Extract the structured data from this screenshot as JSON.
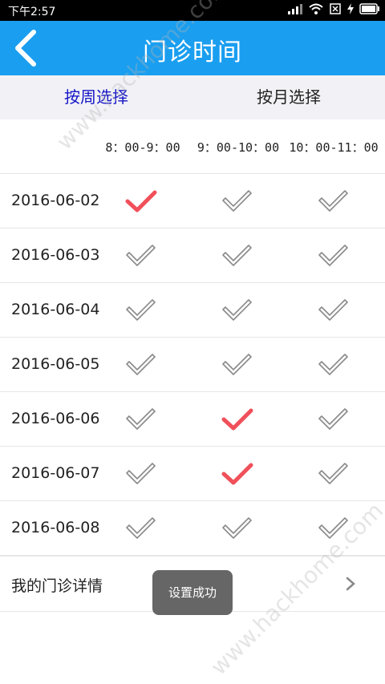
{
  "status_bar": {
    "time": "下午2:57"
  },
  "header": {
    "title": "门诊时间"
  },
  "tabs": [
    {
      "label": "按周选择",
      "active": true
    },
    {
      "label": "按月选择",
      "active": false
    }
  ],
  "schedule": {
    "time_slots": [
      "8：00-9：00",
      "9：00-10：00",
      "10：00-11：00"
    ],
    "rows": [
      {
        "date": "2016-06-02",
        "selected": [
          true,
          false,
          false
        ]
      },
      {
        "date": "2016-06-03",
        "selected": [
          false,
          false,
          false
        ]
      },
      {
        "date": "2016-06-04",
        "selected": [
          false,
          false,
          false
        ]
      },
      {
        "date": "2016-06-05",
        "selected": [
          false,
          false,
          false
        ]
      },
      {
        "date": "2016-06-06",
        "selected": [
          false,
          true,
          false
        ]
      },
      {
        "date": "2016-06-07",
        "selected": [
          false,
          true,
          false
        ]
      },
      {
        "date": "2016-06-08",
        "selected": [
          false,
          false,
          false
        ]
      }
    ]
  },
  "detail": {
    "label": "我的门诊详情"
  },
  "toast": {
    "message": "设置成功"
  },
  "watermark": "www.hackhome.com",
  "colors": {
    "header_bg": "#1a9ef0",
    "active_tab": "#1515c8",
    "check_selected": "#f0505a",
    "check_unselected": "#8a8a8a"
  }
}
